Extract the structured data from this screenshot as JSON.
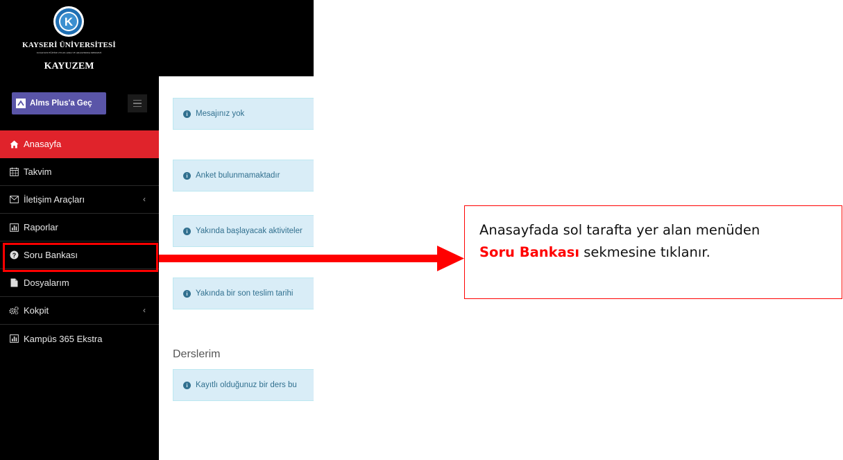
{
  "brand": {
    "university_name": "KAYSERİ ÜNİVERSİTESİ",
    "center_subtitle": "UZAKTAN EĞİTİM UYGULAMA VE ARAŞTIRMA MERKEZİ",
    "center_name": "KAYUZEM"
  },
  "sidebar": {
    "alms_button_label": "Alms Plus'a Geç",
    "items": [
      {
        "label": "Anasayfa",
        "icon": "home-icon",
        "active": true
      },
      {
        "label": "Takvim",
        "icon": "calendar-icon"
      },
      {
        "label": "İletişim Araçları",
        "icon": "envelope-icon",
        "has_submenu": true
      },
      {
        "label": "Raporlar",
        "icon": "bar-chart-icon"
      },
      {
        "label": "Soru Bankası",
        "icon": "question-circle-icon"
      },
      {
        "label": "Dosyalarım",
        "icon": "file-icon"
      },
      {
        "label": "Kokpit",
        "icon": "gears-icon",
        "has_submenu": true
      },
      {
        "label": "Kampüs 365 Ekstra",
        "icon": "bar-chart-icon"
      }
    ],
    "chevron": "‹"
  },
  "content": {
    "alerts": [
      "Mesajınız yok",
      "Anket bulunmamaktadır",
      "Yakında başlayacak aktiviteler",
      "Yakında bir son teslim tarihi",
      "Kayıtlı olduğunuz bir ders bu"
    ],
    "courses_heading": "Derslerim"
  },
  "annotation": {
    "text_before": "Anasayfada sol tarafta yer alan menüden",
    "highlight": "Soru Bankası",
    "text_after": "sekmesine tıklanır.",
    "color": "#ff0000"
  },
  "colors": {
    "sidebar_bg": "#000000",
    "active_item": "#e0232b",
    "alms_button": "#5a55a8",
    "alert_bg": "#d9edf7",
    "alert_text": "#31708f"
  }
}
